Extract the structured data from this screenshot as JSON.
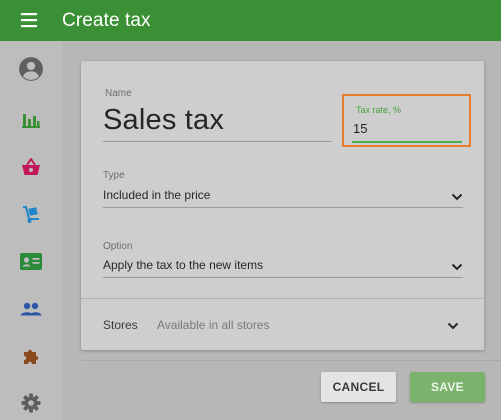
{
  "app": {
    "title": "Create tax",
    "menu_icon": "hamburger-menu-icon",
    "colors": {
      "app_bar": "#3b8f34",
      "accent": "#4caf50",
      "highlight": "#e87c2e"
    }
  },
  "sidebar": {
    "items": [
      {
        "icon": "account-circle-icon",
        "color": "#5f5f5f"
      },
      {
        "icon": "bar-chart-icon",
        "color": "#3b8f34"
      },
      {
        "icon": "basket-icon",
        "color": "#c2185b"
      },
      {
        "icon": "dolly-icon",
        "color": "#1f86c8"
      },
      {
        "icon": "id-card-icon",
        "color": "#2a8a3a"
      },
      {
        "icon": "people-icon",
        "color": "#2e56a8"
      },
      {
        "icon": "puzzle-icon",
        "color": "#8a4a1e"
      },
      {
        "icon": "gear-icon",
        "color": "#5f5f5f"
      }
    ]
  },
  "form": {
    "name": {
      "label": "Name",
      "value": "Sales tax"
    },
    "tax_rate": {
      "label": "Tax rate, %",
      "value": "15"
    },
    "type": {
      "label": "Type",
      "value": "Included in the price"
    },
    "option": {
      "label": "Option",
      "value": "Apply the tax to the new items"
    },
    "stores": {
      "label": "Stores",
      "value": "Available in all stores"
    }
  },
  "actions": {
    "cancel_label": "CANCEL",
    "save_label": "SAVE"
  }
}
